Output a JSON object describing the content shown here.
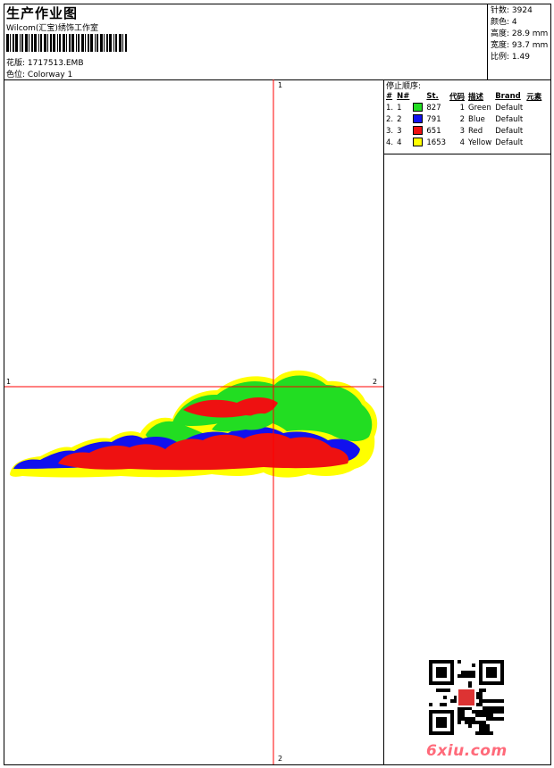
{
  "header": {
    "title": "生产作业图",
    "studio": "Wilcom(汇宝)绣饰工作室",
    "design_label": "花版:",
    "design_file": "1717513.EMB",
    "colorway_label": "色位:",
    "colorway": "Colorway 1"
  },
  "stats": {
    "stitches": "针数: 3924",
    "colors": "颜色: 4",
    "height": "高度: 28.9 mm",
    "width": "宽度: 93.7 mm",
    "ratio": "比例: 1.49"
  },
  "sequence": {
    "title": "停止顺序:",
    "headers": [
      "#",
      "N#",
      "",
      "St.",
      "代码",
      "描述",
      "Brand",
      "元素"
    ],
    "rows": [
      {
        "idx": "1.",
        "n": "1",
        "color": "#22dd22",
        "st": "827",
        "code": "1",
        "desc": "Green",
        "brand": "Default"
      },
      {
        "idx": "2.",
        "n": "2",
        "color": "#1111ee",
        "st": "791",
        "code": "2",
        "desc": "Blue",
        "brand": "Default"
      },
      {
        "idx": "3.",
        "n": "3",
        "color": "#ee1111",
        "st": "651",
        "code": "3",
        "desc": "Red",
        "brand": "Default"
      },
      {
        "idx": "4.",
        "n": "4",
        "color": "#ffff00",
        "st": "1653",
        "code": "4",
        "desc": "Yellow",
        "brand": "Default"
      }
    ]
  },
  "axes": {
    "top": "1",
    "bottom": "2",
    "left": "1",
    "right": "2",
    "color": "#ff0000"
  },
  "watermark": {
    "prefix": "6xiu",
    "suffix": ".com"
  },
  "thread_colors": {
    "green": "#22dd22",
    "blue": "#1111ee",
    "red": "#ee1111",
    "yellow": "#ffff00"
  }
}
